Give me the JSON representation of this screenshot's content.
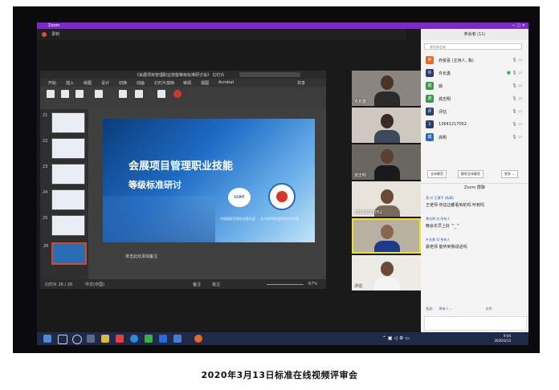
{
  "caption": "2020年3月13日标准在线视频评审会",
  "zoom": {
    "app_title": "Zoom",
    "top_label": "录制",
    "window_buttons": "— ▢ ✕"
  },
  "ppt": {
    "window_title": "《会展项目管理职业技能等级标准研讨会》 幻灯片",
    "menu": [
      "开始",
      "插入",
      "绘图",
      "设计",
      "切换",
      "动画",
      "幻灯片放映",
      "审阅",
      "视图",
      "Acrobat"
    ],
    "share_label": "共享",
    "slide_numbers": [
      "21",
      "22",
      "23",
      "24",
      "25",
      "26"
    ],
    "slide": {
      "title_line1": "会展项目管理职业技能",
      "title_line2": "等级标准研讨",
      "logo1": "CCPIT",
      "org1": "中国国际贸易促进委员会",
      "org2": "长沙商贸旅游职业技术学院"
    },
    "notes_placeholder": "单击此处添加备注",
    "status_left": "幻灯片 26 / 26",
    "status_lang": "中文(中国)",
    "notes_btn": "备注",
    "comments_btn": "批注",
    "zoom_pct": "67%"
  },
  "videos": [
    {
      "name": "许长勇"
    },
    {
      "name": ""
    },
    {
      "name": "龚志明"
    },
    {
      "name": "13641217052"
    },
    {
      "name": ""
    },
    {
      "name": "评估"
    }
  ],
  "participants": {
    "header": "参会者 (11)",
    "search_placeholder": "查找参会者",
    "list": [
      {
        "initial": "乔",
        "name": "乔俊喜 (主持人, 我)",
        "color": "#e06a2a"
      },
      {
        "initial": "许",
        "name": "许长勇",
        "color": "#2a3f6a"
      },
      {
        "initial": "娟",
        "name": "娟",
        "color": "#3a9a4a"
      },
      {
        "initial": "龚",
        "name": "龚志明",
        "color": "#3a9a4a"
      },
      {
        "initial": "评",
        "name": "评估",
        "color": "#2a3f6a"
      },
      {
        "initial": "1",
        "name": "13641217052",
        "color": "#2a3f6a"
      },
      {
        "initial": "高",
        "name": "高明",
        "color": "#2a6ab8"
      }
    ],
    "btn_mute_all": "全体静音",
    "btn_unmute_all": "解除全体静音",
    "btn_more": "更多 ⌄"
  },
  "chat": {
    "header": "Zoom 群聊",
    "messages": [
      {
        "from": "我 对 王建平 (私聊)",
        "text": "王老师 你这边都看到的吗 听到吗"
      },
      {
        "from": "龚志明 对 所有人",
        "text": "晚会长早上好 ^_^"
      },
      {
        "from": "许长勇 对 所有人",
        "text": "晨老师 能听到我说话吗"
      }
    ],
    "send_to_label": "发送:",
    "send_to_value": "所有人 ⌄",
    "file_label": "文件"
  },
  "taskbar": {
    "time": "9:44",
    "date": "2020/3/13"
  }
}
